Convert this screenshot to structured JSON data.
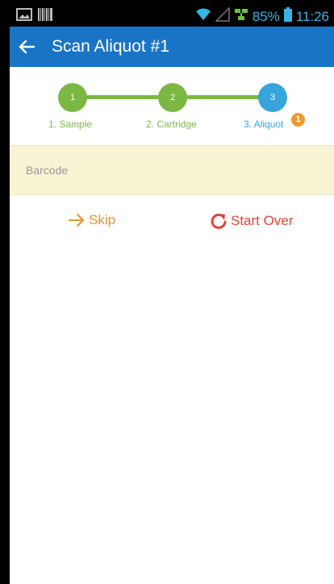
{
  "status_bar": {
    "battery_text": "85%",
    "time": "11:26",
    "icons": [
      "image-icon",
      "barcode-icon",
      "wifi-icon",
      "signal-icon",
      "network-icon",
      "battery-icon"
    ]
  },
  "app_bar": {
    "back_icon": "arrow-left-icon",
    "title": "Scan Aliquot #1",
    "color": "#1a74c6"
  },
  "stepper": {
    "steps": [
      {
        "number": "1",
        "label": "1. Sample",
        "state": "complete",
        "color": "#7bb843"
      },
      {
        "number": "2",
        "label": "2. Cartridge",
        "state": "complete",
        "color": "#7bb843"
      },
      {
        "number": "3",
        "label": "3. Aliquot",
        "state": "current",
        "color": "#37a5db",
        "badge": "1",
        "badge_color": "#f0982a"
      }
    ]
  },
  "barcode": {
    "placeholder": "Barcode",
    "value": "",
    "background": "#f8f3d3"
  },
  "actions": {
    "skip": {
      "label": "Skip",
      "icon": "arrow-right-icon",
      "color": "#e8912f"
    },
    "start_over": {
      "label": "Start Over",
      "icon": "refresh-icon",
      "color": "#e0453a"
    }
  }
}
